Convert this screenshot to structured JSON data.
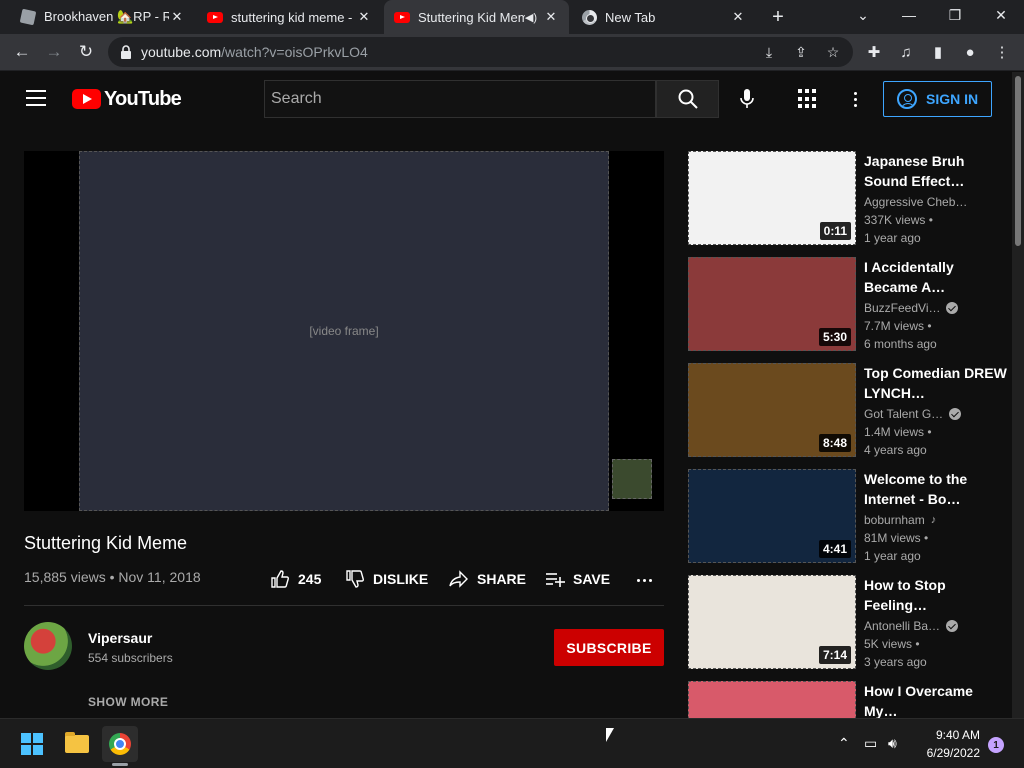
{
  "browser": {
    "tabs": [
      {
        "title": "Brookhaven 🏡RP - Ro",
        "favicon": "roblox-icon",
        "active": false
      },
      {
        "title": "stuttering kid meme - Y",
        "favicon": "youtube-icon",
        "active": false
      },
      {
        "title": "Stuttering Kid Mem",
        "favicon": "youtube-icon",
        "active": true,
        "audio": true
      },
      {
        "title": "New Tab",
        "favicon": "chrome-icon",
        "active": false
      }
    ],
    "url_host": "youtube.com",
    "url_path": "/watch?v=oisOPrkvLO4"
  },
  "youtube": {
    "logo_text": "YouTube",
    "search_placeholder": "Search",
    "sign_in_label": "SIGN IN",
    "video": {
      "title": "Stuttering Kid Meme",
      "views_date": "15,885 views • Nov 11, 2018",
      "like_count": "245",
      "dislike_label": "DISLIKE",
      "share_label": "SHARE",
      "save_label": "SAVE"
    },
    "channel": {
      "name": "Vipersaur",
      "subscribers": "554 subscribers",
      "subscribe_label": "SUBSCRIBE",
      "show_more_label": "SHOW MORE"
    },
    "recommendations": [
      {
        "title": "Japanese Bruh Sound Effect…",
        "channel": "Aggressive Cheb…",
        "views": "337K views •",
        "age": "1 year ago",
        "duration": "0:11",
        "verified": false,
        "music": false
      },
      {
        "title": "I Accidentally Became A…",
        "channel": "BuzzFeedVi…",
        "views": "7.7M views •",
        "age": "6 months ago",
        "duration": "5:30",
        "verified": true,
        "music": false
      },
      {
        "title": "Top Comedian DREW LYNCH…",
        "channel": "Got Talent G…",
        "views": "1.4M views •",
        "age": "4 years ago",
        "duration": "8:48",
        "verified": true,
        "music": false
      },
      {
        "title": "Welcome to the Internet - Bo…",
        "channel": "boburnham",
        "views": "81M views •",
        "age": "1 year ago",
        "duration": "4:41",
        "verified": false,
        "music": true
      },
      {
        "title": "How to Stop Feeling…",
        "channel": "Antonelli Ba…",
        "views": "5K views •",
        "age": "3 years ago",
        "duration": "7:14",
        "verified": true,
        "music": false
      },
      {
        "title": "How I Overcame My…",
        "channel": "",
        "views": "",
        "age": "",
        "duration": "",
        "verified": false,
        "music": false
      }
    ]
  },
  "taskbar": {
    "time": "9:40 AM",
    "date": "6/29/2022",
    "notification_count": "1"
  },
  "colors": {
    "youtube_red": "#ff0000",
    "subscribe_red": "#cc0000",
    "link_blue": "#3ea6ff",
    "background": "#0f0f0f"
  }
}
